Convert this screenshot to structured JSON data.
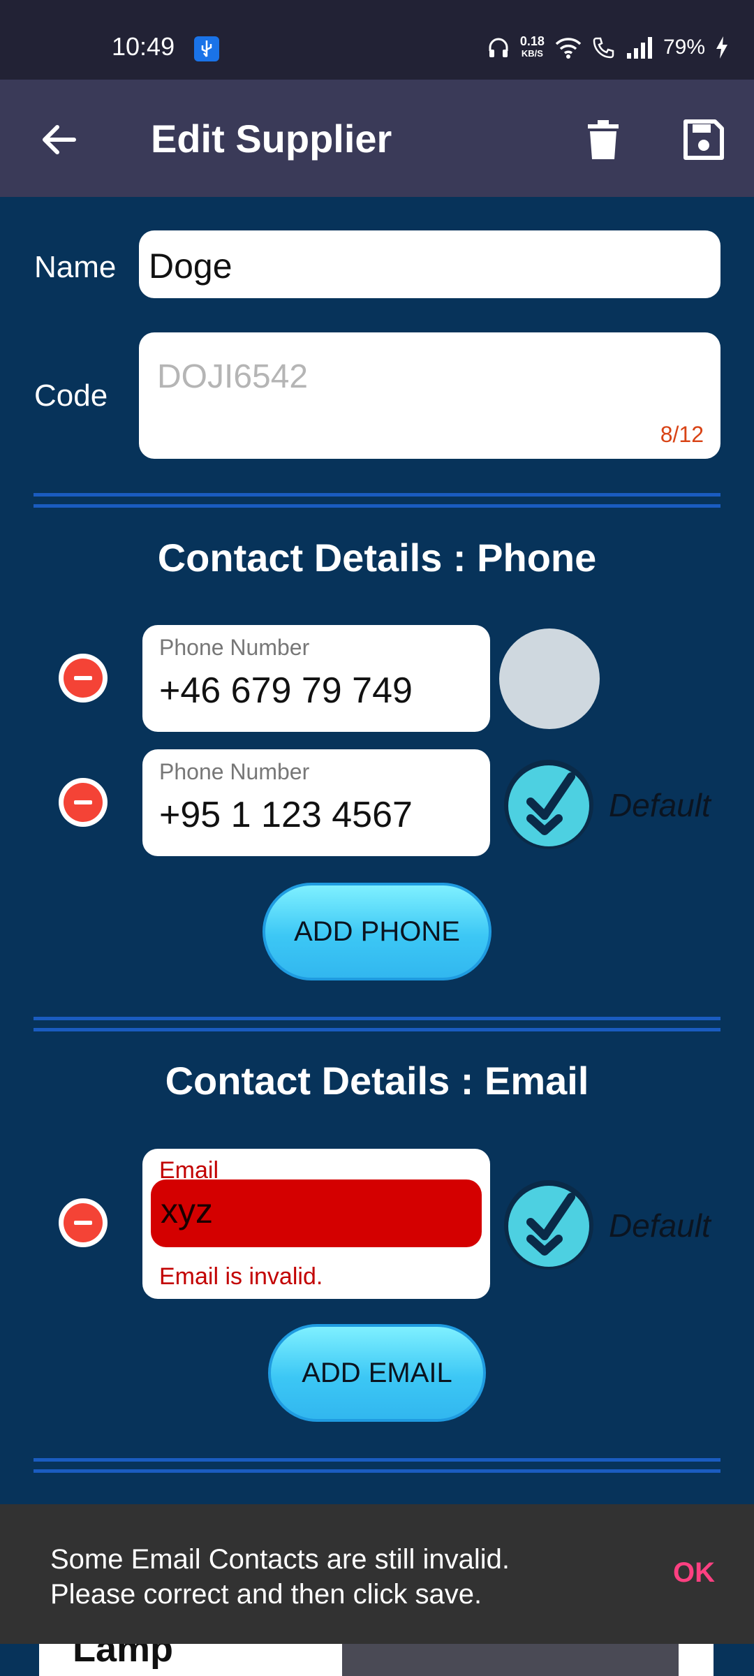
{
  "status_bar": {
    "time": "10:49",
    "net_speed": "0.18",
    "net_unit": "KB/S",
    "battery": "79%"
  },
  "appbar": {
    "title": "Edit Supplier",
    "back_icon": "arrow-left-icon",
    "delete_icon": "trash-icon",
    "save_icon": "floppy-disk-icon"
  },
  "form": {
    "name_label": "Name",
    "name_value": "Doge",
    "code_label": "Code",
    "code_placeholder": "DOJI6542",
    "code_counter": "8/12"
  },
  "phone_section": {
    "title": "Contact Details : Phone",
    "items": [
      {
        "label": "Phone Number",
        "value": "+46 679 79 749",
        "is_default": false,
        "default_text": ""
      },
      {
        "label": "Phone Number",
        "value": "+95 1 123 4567",
        "is_default": true,
        "default_text": "Default"
      }
    ],
    "add_button": "ADD PHONE"
  },
  "email_section": {
    "title": "Contact Details : Email",
    "items": [
      {
        "label": "Email",
        "value": "xyz",
        "error": "Email is invalid.",
        "is_default": true,
        "default_text": "Default"
      }
    ],
    "add_button": "ADD EMAIL"
  },
  "snackbar": {
    "line1": "Some Email Contacts are still invalid.",
    "line2": "Please correct and then click save.",
    "action": "OK"
  },
  "bottom_card": {
    "title_fragment": "Lamp"
  },
  "colors": {
    "background": "#07335a",
    "appbar": "#3a3a58",
    "accent_cyan": "#4dd0e1",
    "error_red": "#d40000",
    "snackbar_action": "#ff4081"
  }
}
